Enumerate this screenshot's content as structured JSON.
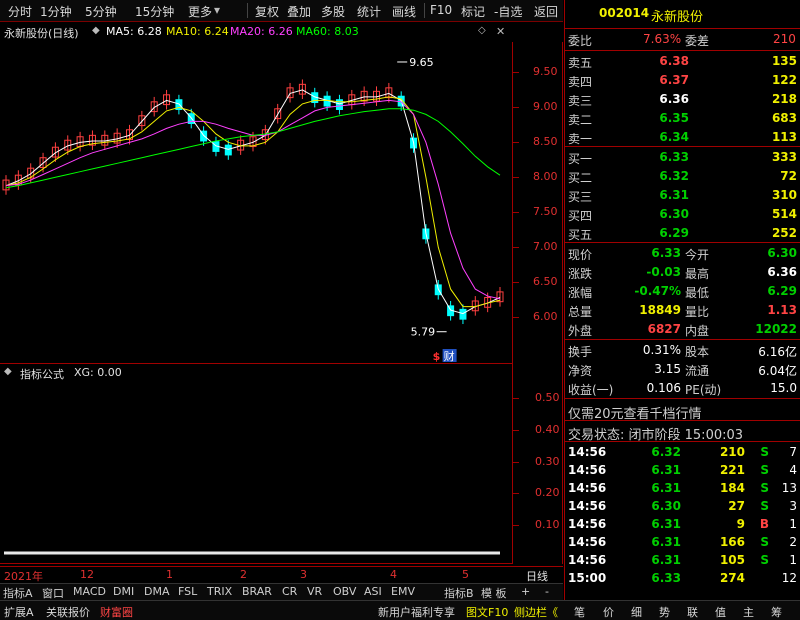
{
  "toolbar": {
    "items": [
      "分时",
      "1分钟",
      "5分钟",
      "15分钟",
      "更多",
      "复权",
      "叠加",
      "多股",
      "统计",
      "画线",
      "F10",
      "标记",
      "-自选",
      "返回"
    ]
  },
  "chart_header": {
    "stock": "永新股份(日线)",
    "ma5": "MA5: 6.28",
    "ma10": "MA10: 6.24",
    "ma20": "MA20: 6.26",
    "ma60": "MA60: 8.03"
  },
  "annotations": {
    "high_label": "9.65",
    "low_label": "5.79",
    "marker_s": "$",
    "marker_cai": "财"
  },
  "indicator": {
    "title": "指标公式",
    "value": "XG: 0.00"
  },
  "colors": {
    "ma5": "#ffffff",
    "ma10": "#f0f000",
    "ma20": "#ff40ff",
    "ma60": "#00ff00",
    "up": "#ff4040",
    "down": "#00ffff",
    "axis": "#e03030",
    "frame": "#a00000"
  },
  "chart_data": [
    {
      "type": "line",
      "title": "永新股份(日线)",
      "ylim": [
        5.6,
        9.85
      ],
      "y_ticks": [
        "9.50",
        "9.00",
        "8.50",
        "8.00",
        "7.50",
        "7.00",
        "6.50",
        "6.00"
      ],
      "x_ticks": [
        "2021年",
        "12",
        "1",
        "2",
        "3",
        "4",
        "5"
      ],
      "series": [
        {
          "name": "MA5",
          "values": [
            7.88,
            7.95,
            8.05,
            8.2,
            8.35,
            8.45,
            8.5,
            8.52,
            8.52,
            8.55,
            8.6,
            8.8,
            9.0,
            9.1,
            9.05,
            8.85,
            8.6,
            8.45,
            8.4,
            8.45,
            8.5,
            8.6,
            8.9,
            9.2,
            9.25,
            9.15,
            9.1,
            9.05,
            9.1,
            9.15,
            9.15,
            9.2,
            9.1,
            8.5,
            7.2,
            6.4,
            6.1,
            6.05,
            6.15,
            6.2,
            6.28
          ]
        },
        {
          "name": "MA10",
          "values": [
            7.88,
            7.92,
            8.0,
            8.12,
            8.25,
            8.36,
            8.44,
            8.48,
            8.5,
            8.52,
            8.55,
            8.65,
            8.8,
            8.95,
            9.0,
            8.95,
            8.8,
            8.62,
            8.5,
            8.45,
            8.45,
            8.5,
            8.65,
            8.9,
            9.05,
            9.1,
            9.1,
            9.08,
            9.08,
            9.1,
            9.12,
            9.15,
            9.12,
            8.9,
            8.0,
            7.0,
            6.4,
            6.15,
            6.15,
            6.2,
            6.24
          ]
        },
        {
          "name": "MA20",
          "values": [
            7.88,
            7.9,
            7.96,
            8.04,
            8.12,
            8.2,
            8.28,
            8.35,
            8.4,
            8.45,
            8.5,
            8.55,
            8.62,
            8.7,
            8.76,
            8.8,
            8.8,
            8.76,
            8.7,
            8.65,
            8.6,
            8.6,
            8.65,
            8.75,
            8.85,
            8.95,
            9.0,
            9.02,
            9.04,
            9.06,
            9.08,
            9.1,
            9.08,
            8.9,
            8.5,
            7.9,
            7.2,
            6.7,
            6.4,
            6.3,
            6.26
          ]
        },
        {
          "name": "MA60",
          "values": [
            7.85,
            7.88,
            7.92,
            7.96,
            8.0,
            8.04,
            8.08,
            8.12,
            8.16,
            8.2,
            8.24,
            8.28,
            8.32,
            8.36,
            8.4,
            8.44,
            8.48,
            8.52,
            8.55,
            8.58,
            8.6,
            8.62,
            8.65,
            8.7,
            8.75,
            8.8,
            8.84,
            8.88,
            8.91,
            8.94,
            8.96,
            8.98,
            8.98,
            8.96,
            8.9,
            8.8,
            8.65,
            8.48,
            8.3,
            8.15,
            8.03
          ]
        }
      ]
    },
    {
      "type": "line",
      "title": "指标公式",
      "ylim": [
        0,
        0.55
      ],
      "y_ticks": [
        "0.50",
        "0.40",
        "0.30",
        "0.20",
        "0.10"
      ],
      "series": [
        {
          "values": [
            0,
            0,
            0,
            0,
            0
          ]
        }
      ]
    }
  ],
  "quote": {
    "code": "002014",
    "name": "永新股份",
    "weibi_label": "委比",
    "weibi": "7.63%",
    "weicha_label": "委差",
    "weicha": "210",
    "asks": [
      {
        "label": "卖五",
        "price": "6.38",
        "vol": "135"
      },
      {
        "label": "卖四",
        "price": "6.37",
        "vol": "122"
      },
      {
        "label": "卖三",
        "price": "6.36",
        "vol": "218"
      },
      {
        "label": "卖二",
        "price": "6.35",
        "vol": "683"
      },
      {
        "label": "卖一",
        "price": "6.34",
        "vol": "113"
      }
    ],
    "bids": [
      {
        "label": "买一",
        "price": "6.33",
        "vol": "333"
      },
      {
        "label": "买二",
        "price": "6.32",
        "vol": "72"
      },
      {
        "label": "买三",
        "price": "6.31",
        "vol": "310"
      },
      {
        "label": "买四",
        "price": "6.30",
        "vol": "514"
      },
      {
        "label": "买五",
        "price": "6.29",
        "vol": "252"
      }
    ],
    "stats": [
      {
        "l1": "现价",
        "v1": "6.33",
        "l2": "今开",
        "v2": "6.30"
      },
      {
        "l1": "涨跌",
        "v1": "-0.03",
        "l2": "最高",
        "v2": "6.36"
      },
      {
        "l1": "涨幅",
        "v1": "-0.47%",
        "l2": "最低",
        "v2": "6.29"
      },
      {
        "l1": "总量",
        "v1": "18849",
        "l2": "量比",
        "v2": "1.13"
      },
      {
        "l1": "外盘",
        "v1": "6827",
        "l2": "内盘",
        "v2": "12022"
      }
    ],
    "fund": [
      {
        "l1": "换手",
        "v1": "0.31%",
        "l2": "股本",
        "v2": "6.16亿"
      },
      {
        "l1": "净资",
        "v1": "3.15",
        "l2": "流通",
        "v2": "6.04亿"
      },
      {
        "l1": "收益(一)",
        "v1": "0.106",
        "l2": "PE(动)",
        "v2": "15.0"
      }
    ],
    "promo": "仅需20元查看千档行情",
    "status": "交易状态: 闭市阶段 15:00:03",
    "ticks": [
      {
        "time": "14:56",
        "price": "6.32",
        "vol": "210",
        "side": "S",
        "n": "7"
      },
      {
        "time": "14:56",
        "price": "6.31",
        "vol": "221",
        "side": "S",
        "n": "4"
      },
      {
        "time": "14:56",
        "price": "6.31",
        "vol": "184",
        "side": "S",
        "n": "13"
      },
      {
        "time": "14:56",
        "price": "6.30",
        "vol": "27",
        "side": "S",
        "n": "3"
      },
      {
        "time": "14:56",
        "price": "6.31",
        "vol": "9",
        "side": "B",
        "n": "1"
      },
      {
        "time": "14:56",
        "price": "6.31",
        "vol": "166",
        "side": "S",
        "n": "2"
      },
      {
        "time": "14:56",
        "price": "6.31",
        "vol": "105",
        "side": "S",
        "n": "1"
      },
      {
        "time": "15:00",
        "price": "6.33",
        "vol": "274",
        "side": "",
        "n": "12"
      }
    ]
  },
  "date_axis": {
    "labels": [
      "2021年",
      "12",
      "1",
      "2",
      "3",
      "4",
      "5"
    ],
    "right_label": "日线"
  },
  "indicator_tabs": [
    "指标A",
    "窗口",
    "MACD",
    "DMI",
    "DMA",
    "FSL",
    "TRIX",
    "BRAR",
    "CR",
    "VR",
    "OBV",
    "ASI",
    "EMV",
    "指标B",
    "模 板",
    "+",
    "-"
  ],
  "bottom_bar": {
    "left": [
      "扩展A",
      "关联报价",
      "财富圈"
    ],
    "middle": [
      "新用户福利专享",
      "图文F10",
      "侧边栏《"
    ],
    "right": [
      "笔",
      "价",
      "细",
      "势",
      "联",
      "值",
      "主",
      "筹"
    ]
  }
}
